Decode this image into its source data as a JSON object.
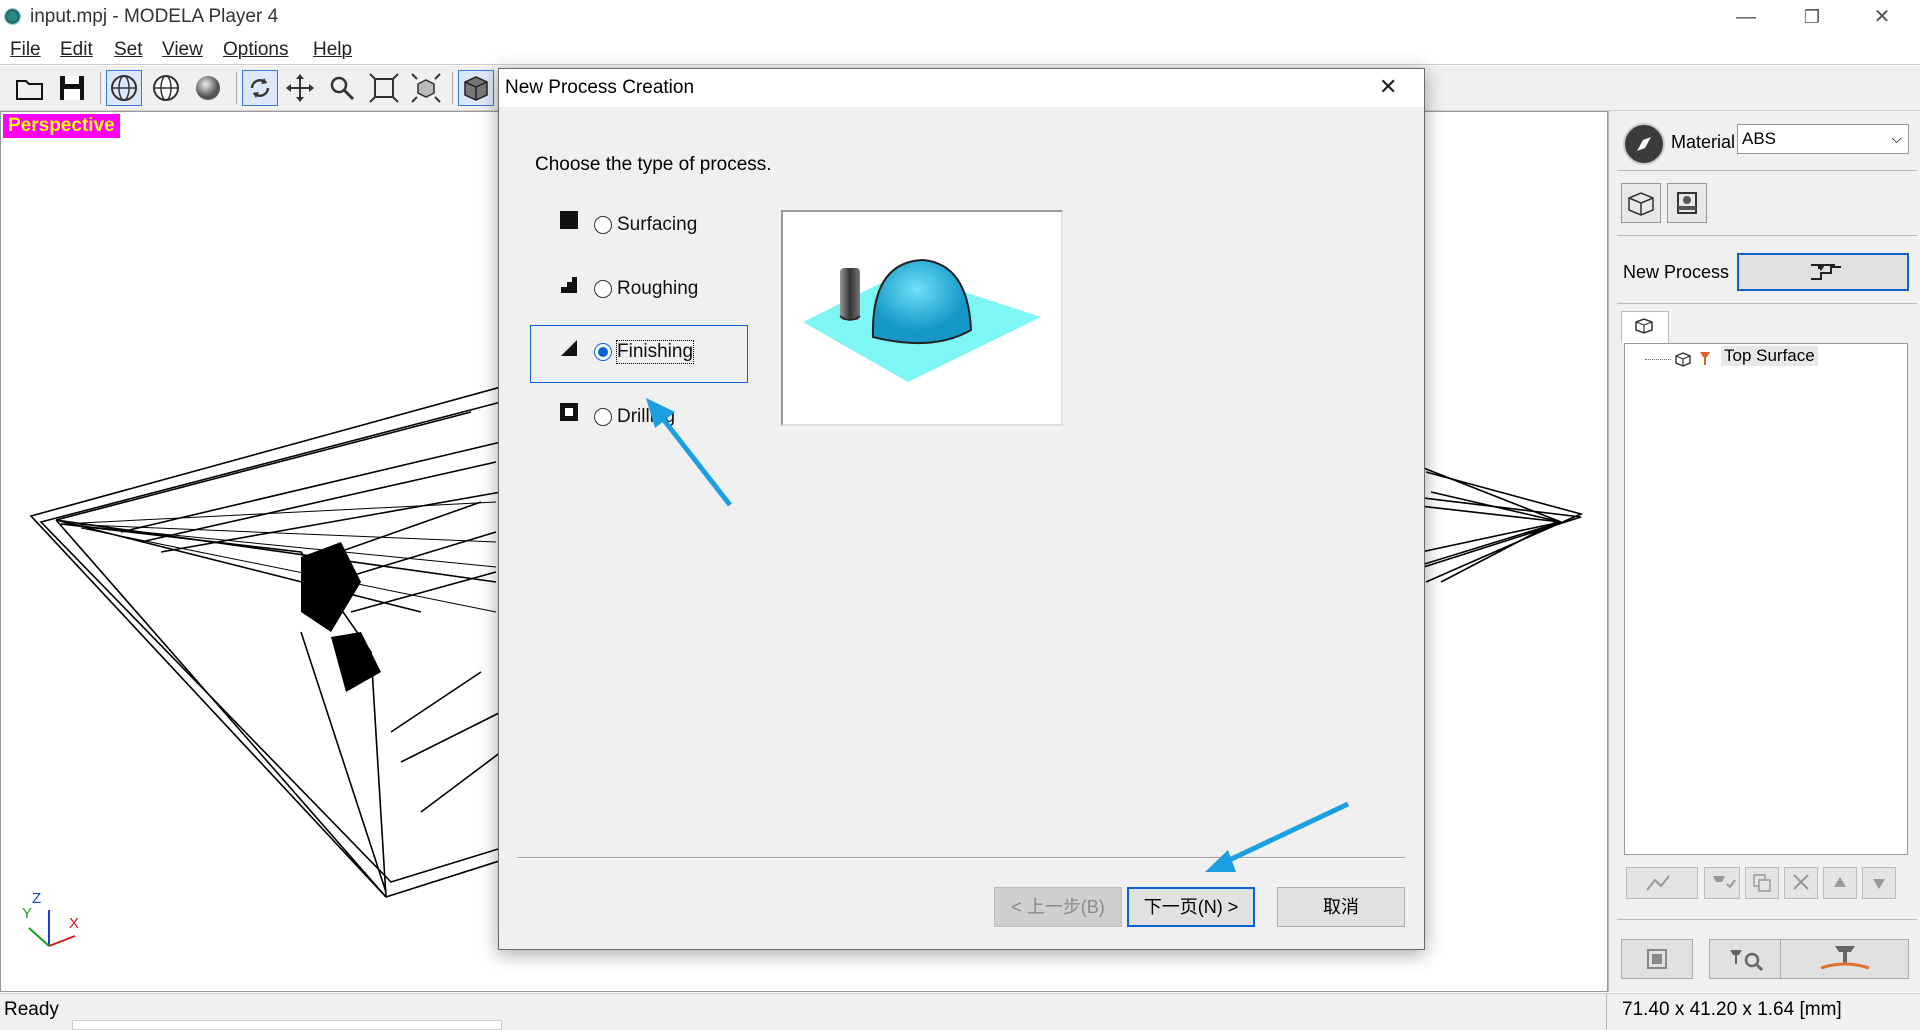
{
  "window": {
    "title": "input.mpj - MODELA Player 4",
    "minimize": "—",
    "restore": "❐",
    "close": "✕"
  },
  "menu": [
    "File",
    "Edit",
    "Set",
    "View",
    "Options",
    "Help"
  ],
  "viewport": {
    "view_label": "Perspective",
    "axes": {
      "x": "X",
      "y": "Y",
      "z": "Z"
    }
  },
  "right_panel": {
    "material_label": "Material",
    "material_value": "ABS",
    "new_process_label": "New Process",
    "tree_item": "Top Surface"
  },
  "dialog": {
    "title": "New Process Creation",
    "close": "✕",
    "prompt": "Choose the type of process.",
    "options": [
      {
        "label": "Surfacing",
        "selected": false
      },
      {
        "label": "Roughing",
        "selected": false
      },
      {
        "label": "Finishing",
        "selected": true
      },
      {
        "label": "Drilling",
        "selected": false
      }
    ],
    "buttons": {
      "back": "< 上一步(B)",
      "next": "下一页(N) >",
      "cancel": "取消"
    }
  },
  "status": {
    "left": "Ready",
    "right": "71.40 x 41.20 x 1.64 [mm]"
  },
  "colors": {
    "accent": "#0a64d0",
    "annotation_arrow": "#1aa0e0",
    "perspective_bg": "#ff00ff",
    "perspective_text": "#ffff00",
    "preview_plane": "#7ff6f6",
    "preview_dome": "#2ec4ea"
  }
}
